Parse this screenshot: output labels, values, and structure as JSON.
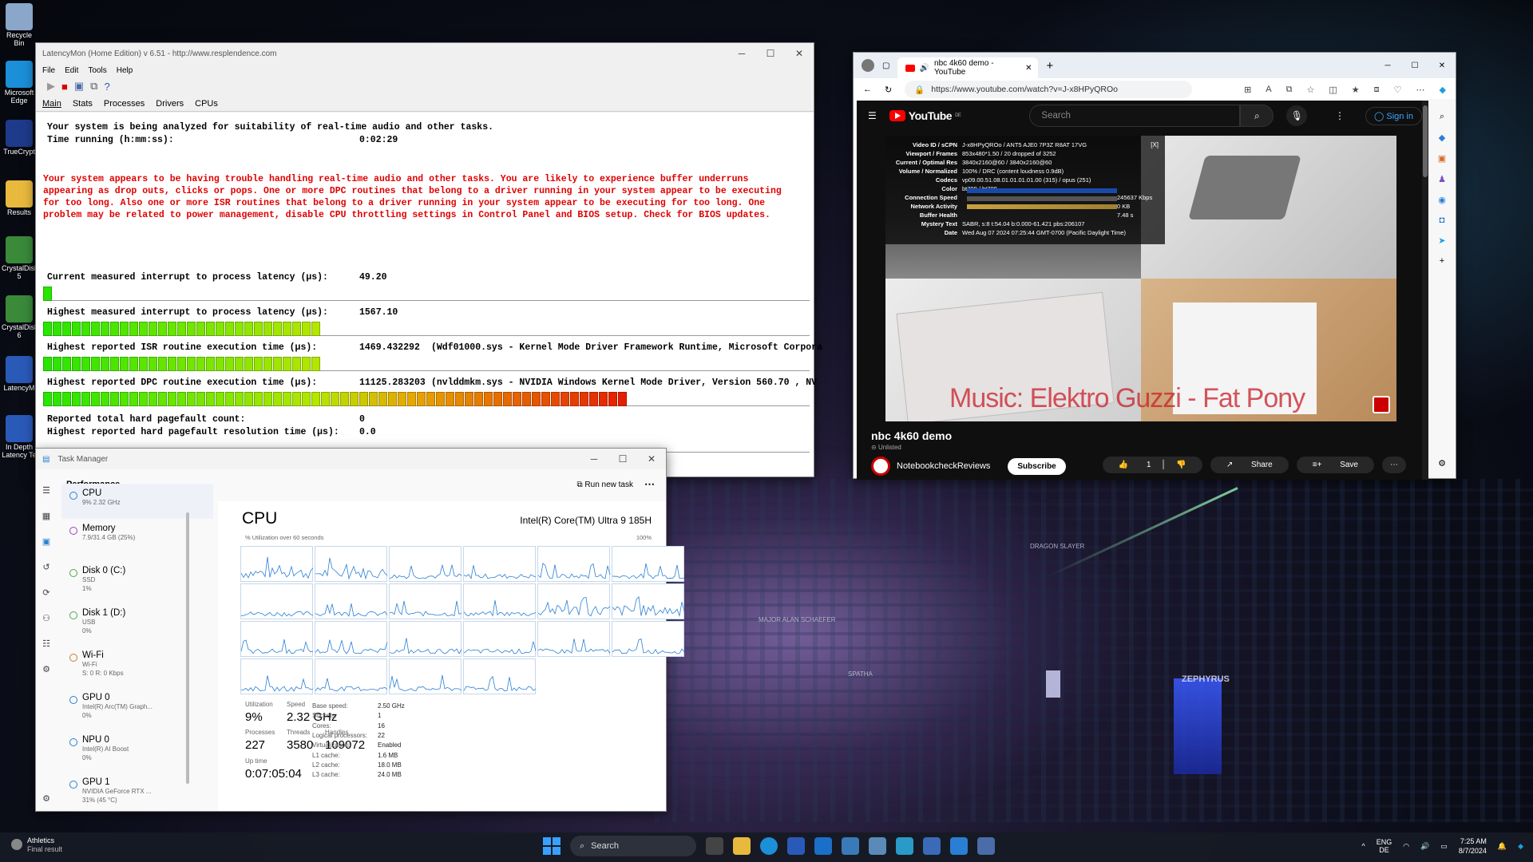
{
  "desktop": {
    "icons": [
      {
        "label": "Recycle Bin",
        "color": "#8aa6c8"
      },
      {
        "label": "Microsoft Edge",
        "color": "#1b8fd8"
      },
      {
        "label": "TrueCrypt",
        "color": "#1e3a8a"
      },
      {
        "label": "Results",
        "color": "#e8b93c"
      },
      {
        "label": "CrystalDisk 5",
        "color": "#3a8a3a"
      },
      {
        "label": "CrystalDisk 6",
        "color": "#3a8a3a"
      },
      {
        "label": "LatencyM",
        "color": "#2a5ab8"
      },
      {
        "label": "In Depth Latency Te",
        "color": "#2a5ab8"
      }
    ],
    "wallpaper_labels": {
      "sign": "ZEPHYRUS",
      "tower": "DRAGON SLAYER",
      "block": "MAJOR ALAN SCHAEFER",
      "spatha": "SPATHA"
    }
  },
  "latencymon": {
    "title": "LatencyMon (Home Edition) v 6.51 - http://www.resplendence.com",
    "menu": [
      "File",
      "Edit",
      "Tools",
      "Help"
    ],
    "tabs": [
      "Main",
      "Stats",
      "Processes",
      "Drivers",
      "CPUs"
    ],
    "line1": "Your system is being analyzed for suitability of real-time audio and other tasks.",
    "time_label": "Time running (h:mm:ss):",
    "time_value": "0:02:29",
    "warning": "Your system appears to be having trouble handling real-time audio and other tasks. You are likely to experience buffer underruns appearing as drop outs, clicks or pops. One or more DPC routines that belong to a driver running in your system appear to be executing for too long. Also one or more ISR routines that belong to a driver running in your system appear to be executing for too long. One problem may be related to power management, disable CPU throttling settings in Control Panel and BIOS setup. Check for BIOS updates.",
    "metrics": [
      {
        "label": "Current measured interrupt to process latency (µs):",
        "value": "49.20",
        "bar_fraction": 0.012
      },
      {
        "label": "Highest measured interrupt to process latency (µs):",
        "value": "1567.10",
        "bar_fraction": 0.36
      },
      {
        "label": "Highest reported ISR routine execution time (µs):",
        "value": "1469.432292",
        "detail": "(Wdf01000.sys - Kernel Mode Driver Framework Runtime, Microsoft Corpora",
        "bar_fraction": 0.36
      },
      {
        "label": "Highest reported DPC routine execution time (µs):",
        "value": "11125.283203",
        "detail": "(nvlddmkm.sys - NVIDIA Windows Kernel Mode Driver, Version 560.70 , NV",
        "bar_fraction": 0.76
      }
    ],
    "pagefault_count_label": "Reported total hard pagefault count:",
    "pagefault_count": "0",
    "pagefault_time_label": "Highest reported hard pagefault resolution time (µs):",
    "pagefault_time": "0.0"
  },
  "taskmanager": {
    "title": "Task Manager",
    "section": "Performance",
    "run_new_task": "Run new task",
    "sidebar": [
      {
        "name": "CPU",
        "sub": "9% 2.32 GHz",
        "color": "#2a7fd4"
      },
      {
        "name": "Memory",
        "sub": "7.9/31.4 GB (25%)",
        "color": "#a040c0"
      },
      {
        "name": "Disk 0 (C:)",
        "sub": "SSD",
        "sub2": "1%",
        "color": "#4aa84a"
      },
      {
        "name": "Disk 1 (D:)",
        "sub": "USB",
        "sub2": "0%",
        "color": "#4aa84a"
      },
      {
        "name": "Wi-Fi",
        "sub": "Wi-Fi",
        "sub2": "S: 0 R: 0 Kbps",
        "color": "#c87a30"
      },
      {
        "name": "GPU 0",
        "sub": "Intel(R) Arc(TM) Graph...",
        "sub2": "0%",
        "color": "#2a7fd4"
      },
      {
        "name": "NPU 0",
        "sub": "Intel(R) AI Boost",
        "sub2": "0%",
        "color": "#2a7fd4"
      },
      {
        "name": "GPU 1",
        "sub": "NVIDIA GeForce RTX ...",
        "sub2": "31% (45 °C)",
        "color": "#2a7fd4"
      }
    ],
    "cpu_title": "CPU",
    "cpu_model": "Intel(R) Core(TM) Ultra 9 185H",
    "util_caption": "% Utilization over 60 seconds",
    "util_max": "100%",
    "stats": {
      "utilization_label": "Utilization",
      "utilization": "9%",
      "speed_label": "Speed",
      "speed": "2.32 GHz",
      "processes_label": "Processes",
      "processes": "227",
      "threads_label": "Threads",
      "threads": "3580",
      "handles_label": "Handles",
      "handles": "109072",
      "uptime_label": "Up time",
      "uptime": "0:07:05:04"
    },
    "details": [
      {
        "k": "Base speed:",
        "v": "2.50 GHz"
      },
      {
        "k": "Sockets:",
        "v": "1"
      },
      {
        "k": "Cores:",
        "v": "16"
      },
      {
        "k": "Logical processors:",
        "v": "22"
      },
      {
        "k": "Virtualization:",
        "v": "Enabled"
      },
      {
        "k": "L1 cache:",
        "v": "1.6 MB"
      },
      {
        "k": "L2 cache:",
        "v": "18.0 MB"
      },
      {
        "k": "L3 cache:",
        "v": "24.0 MB"
      }
    ]
  },
  "edge": {
    "tab_title": "nbc 4k60 demo - YouTube",
    "url": "https://www.youtube.com/watch?v=J-x8HPyQROo",
    "youtube": {
      "logo": "YouTube",
      "region": "DE",
      "search_placeholder": "Search",
      "sign_in": "Sign in",
      "stats": [
        {
          "k": "Video ID / sCPN",
          "v": "J-x8HPyQROo / ANT5 AJE0 7P3Z R8AT 17VG"
        },
        {
          "k": "Viewport / Frames",
          "v": "853x480*1.50 / 20 dropped of 3252"
        },
        {
          "k": "Current / Optimal Res",
          "v": "3840x2160@60 / 3840x2160@60"
        },
        {
          "k": "Volume / Normalized",
          "v": "100% / DRC (content loudness 0.9dB)"
        },
        {
          "k": "Codecs",
          "v": "vp09.00.51.08.01.01.01.01.00 (315) / opus (251)"
        },
        {
          "k": "Color",
          "v": "bt709 / bt709"
        },
        {
          "k": "Connection Speed",
          "v": "245637 Kbps"
        },
        {
          "k": "Network Activity",
          "v": "0 KB"
        },
        {
          "k": "Buffer Health",
          "v": "7.48 s"
        },
        {
          "k": "Mystery Text",
          "v": "SABR, s:8 t:54.04 b:0.000-61.421 pbs:206107"
        },
        {
          "k": "Date",
          "v": "Wed Aug 07 2024 07:25:44 GMT-0700 (Pacific Daylight Time)"
        }
      ],
      "stats_close": "[X]",
      "overlay_text": "Music: Elektro Guzzi - Fat Pony",
      "video_title": "nbc 4k60 demo",
      "visibility": "Unlisted",
      "channel": "NotebookcheckReviews",
      "subscribe": "Subscribe",
      "likes": "1",
      "share": "Share",
      "save": "Save"
    }
  },
  "taskbar": {
    "weather_title": "Athletics",
    "weather_sub": "Final result",
    "search": "Search",
    "lang1": "ENG",
    "lang2": "DE",
    "time": "7:25 AM",
    "date": "8/7/2024"
  }
}
